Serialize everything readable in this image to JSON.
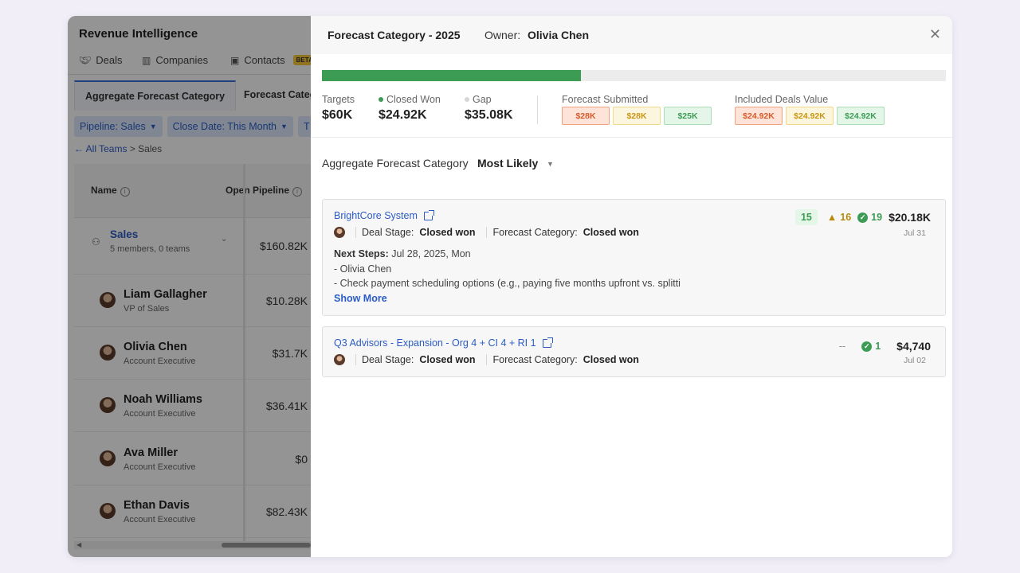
{
  "app": {
    "title": "Revenue Intelligence",
    "nav": [
      {
        "label": "Deals",
        "icon": "handshake-icon"
      },
      {
        "label": "Companies",
        "icon": "building-icon"
      },
      {
        "label": "Contacts",
        "icon": "contact-card-icon",
        "badge": "BETA"
      }
    ],
    "subtabs": [
      "Aggregate Forecast Category",
      "Forecast Category"
    ],
    "filters": [
      "Pipeline: Sales",
      "Close Date: This Month",
      "T"
    ],
    "breadcrumb": {
      "back": "All Teams",
      "sep": " > ",
      "current": "Sales"
    },
    "table": {
      "col_name": "Name",
      "col_pipeline": "Open Pipeline",
      "rows": [
        {
          "name": "Sales",
          "role": "5 members, 0 teams",
          "value": "$160.82K"
        },
        {
          "name": "Liam Gallagher",
          "role": "VP of Sales",
          "value": "$10.28K"
        },
        {
          "name": "Olivia Chen",
          "role": "Account Executive",
          "value": "$31.7K"
        },
        {
          "name": "Noah Williams",
          "role": "Account Executive",
          "value": "$36.41K"
        },
        {
          "name": "Ava Miller",
          "role": "Account Executive",
          "value": "$0"
        },
        {
          "name": "Ethan Davis",
          "role": "Account Executive",
          "value": "$82.43K"
        }
      ]
    }
  },
  "drawer": {
    "title": "Forecast Category - 2025",
    "owner_label": "Owner:",
    "owner": "Olivia Chen",
    "progress_fraction": 0.4153,
    "colors": {
      "green": "#3c9c54",
      "link": "#2b5cc4",
      "warn": "#b88a10"
    },
    "stats": {
      "targets": {
        "label": "Targets",
        "value": "$60K"
      },
      "closed_won": {
        "label": "Closed Won",
        "value": "$24.92K"
      },
      "gap": {
        "label": "Gap",
        "value": "$35.08K"
      }
    },
    "forecast_submitted": {
      "label": "Forecast Submitted",
      "values": [
        "$28K",
        "$28K",
        "$25K"
      ]
    },
    "included_deals": {
      "label": "Included Deals Value",
      "values": [
        "$24.92K",
        "$24.92K",
        "$24.92K"
      ]
    },
    "aggregate": {
      "label": "Aggregate Forecast Category",
      "value": "Most Likely"
    },
    "deals": [
      {
        "name": "BrightCore System",
        "stage_label": "Deal Stage:",
        "stage": "Closed won",
        "category_label": "Forecast Category:",
        "category": "Closed won",
        "count": "15",
        "warnings": "16",
        "checks": "19",
        "amount": "$20.18K",
        "date": "Jul 31",
        "next_steps_label": "Next Steps:",
        "next_steps_date": "Jul 28, 2025, Mon",
        "next_line1": "- Olivia Chen",
        "next_line2": "- Check payment scheduling options (e.g., paying five months upfront vs. splitti",
        "show_more": "Show More"
      },
      {
        "name": "Q3 Advisors - Expansion - Org 4 + CI 4 + RI 1",
        "stage_label": "Deal Stage:",
        "stage": "Closed won",
        "category_label": "Forecast Category:",
        "category": "Closed won",
        "count": "--",
        "checks": "1",
        "amount": "$4,740",
        "date": "Jul 02"
      }
    ]
  }
}
